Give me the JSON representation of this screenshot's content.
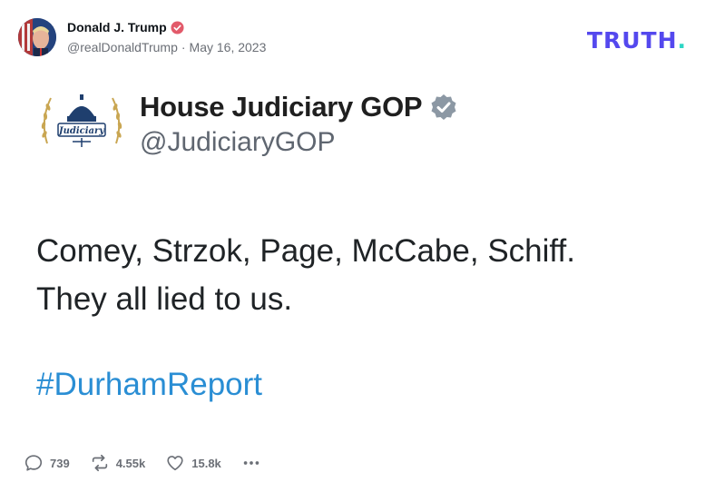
{
  "post": {
    "author_name": "Donald J. Trump",
    "handle": "@realDonaldTrump",
    "separator": "·",
    "date": "May 16, 2023"
  },
  "brand": {
    "logo_text": "TRUTH",
    "logo_dot": ".",
    "color": "#5448ee",
    "dot_color": "#2cd6c5"
  },
  "embed": {
    "org_logo_text": "Judiciary",
    "name": "House Judiciary GOP",
    "handle": "@JudiciaryGOP",
    "text_line1": "Comey, Strzok, Page, McCabe, Schiff.",
    "text_line2": "They all lied to us.",
    "hashtag": "#DurhamReport"
  },
  "actions": {
    "replies": "739",
    "retruths": "4.55k",
    "likes": "15.8k"
  },
  "icons": [
    "verified-badge-icon",
    "reply-icon",
    "retruth-icon",
    "like-icon",
    "more-icon"
  ]
}
